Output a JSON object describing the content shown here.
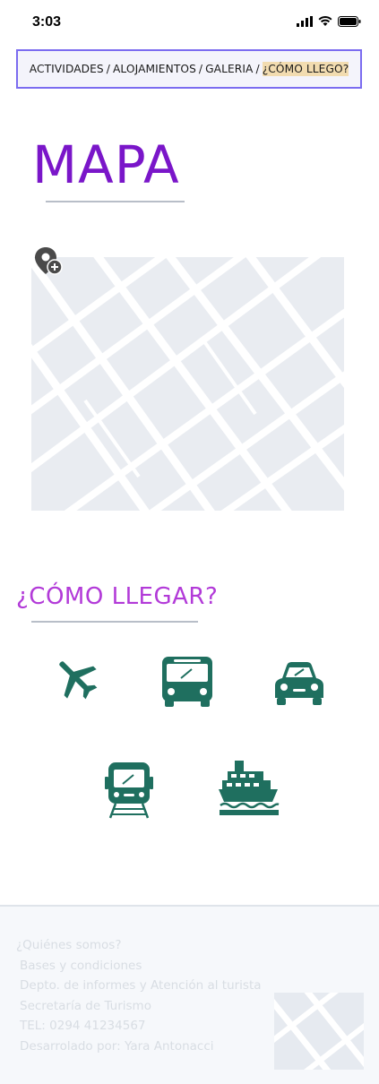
{
  "status_bar": {
    "time": "3:03",
    "icons": [
      "signal-icon",
      "wifi-icon",
      "battery-icon"
    ]
  },
  "breadcrumb": {
    "items": [
      "ACTIVIDADES",
      "ALOJAMIENTOS",
      "GALERIA",
      "¿CÓMO LLEGO?"
    ],
    "separator": "/",
    "active_index": 3
  },
  "map_section": {
    "title": "MAPA",
    "pin_icon": "map-pin-add-icon"
  },
  "howto_section": {
    "title": "¿CÓMO LLEGAR?",
    "transports": [
      {
        "icon": "airplane-icon"
      },
      {
        "icon": "bus-icon"
      },
      {
        "icon": "car-icon"
      },
      {
        "icon": "train-icon"
      },
      {
        "icon": "ship-icon"
      }
    ]
  },
  "footer": {
    "links": [
      "¿Quiénes somos?",
      "Bases y condiciones",
      "Depto. de informes y Atención al turista",
      "Secretaría de Turismo",
      "TEL: 0294 41234567",
      "Desarrolado por: Yara Antonacci"
    ]
  },
  "colors": {
    "accent_purple": "#7a16c9",
    "accent_magenta": "#b23ad8",
    "icon_teal": "#1f6f5f",
    "breadcrumb_border": "#7b6cf0",
    "breadcrumb_highlight": "#f2dcb0"
  }
}
